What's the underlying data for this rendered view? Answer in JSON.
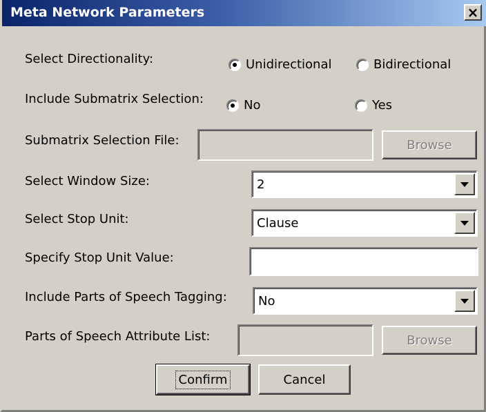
{
  "window": {
    "title": "Meta Network Parameters",
    "close_label": "×"
  },
  "directionality": {
    "label": "Select Directionality:",
    "options": [
      "Unidirectional",
      "Bidirectional"
    ],
    "selected": "Unidirectional"
  },
  "submatrix_selection": {
    "label": "Include Submatrix Selection:",
    "options": [
      "No",
      "Yes"
    ],
    "selected": "No"
  },
  "submatrix_file": {
    "label": "Submatrix Selection File:",
    "value": "",
    "browse_label": "Browse"
  },
  "window_size": {
    "label": "Select Window Size:",
    "value": "2"
  },
  "stop_unit": {
    "label": "Select Stop Unit:",
    "value": "Clause"
  },
  "stop_unit_value": {
    "label": "Specify Stop Unit Value:",
    "value": ""
  },
  "pos_tagging": {
    "label": "Include Parts of Speech Tagging:",
    "value": "No"
  },
  "pos_attribute_list": {
    "label": "Parts of Speech Attribute List:",
    "value": "",
    "browse_label": "Browse"
  },
  "actions": {
    "confirm_label": "Confirm",
    "cancel_label": "Cancel"
  },
  "colors": {
    "titlebar_start": "#0a246a",
    "titlebar_end": "#a6caf0",
    "dialog_background": "#d4d0c8"
  }
}
